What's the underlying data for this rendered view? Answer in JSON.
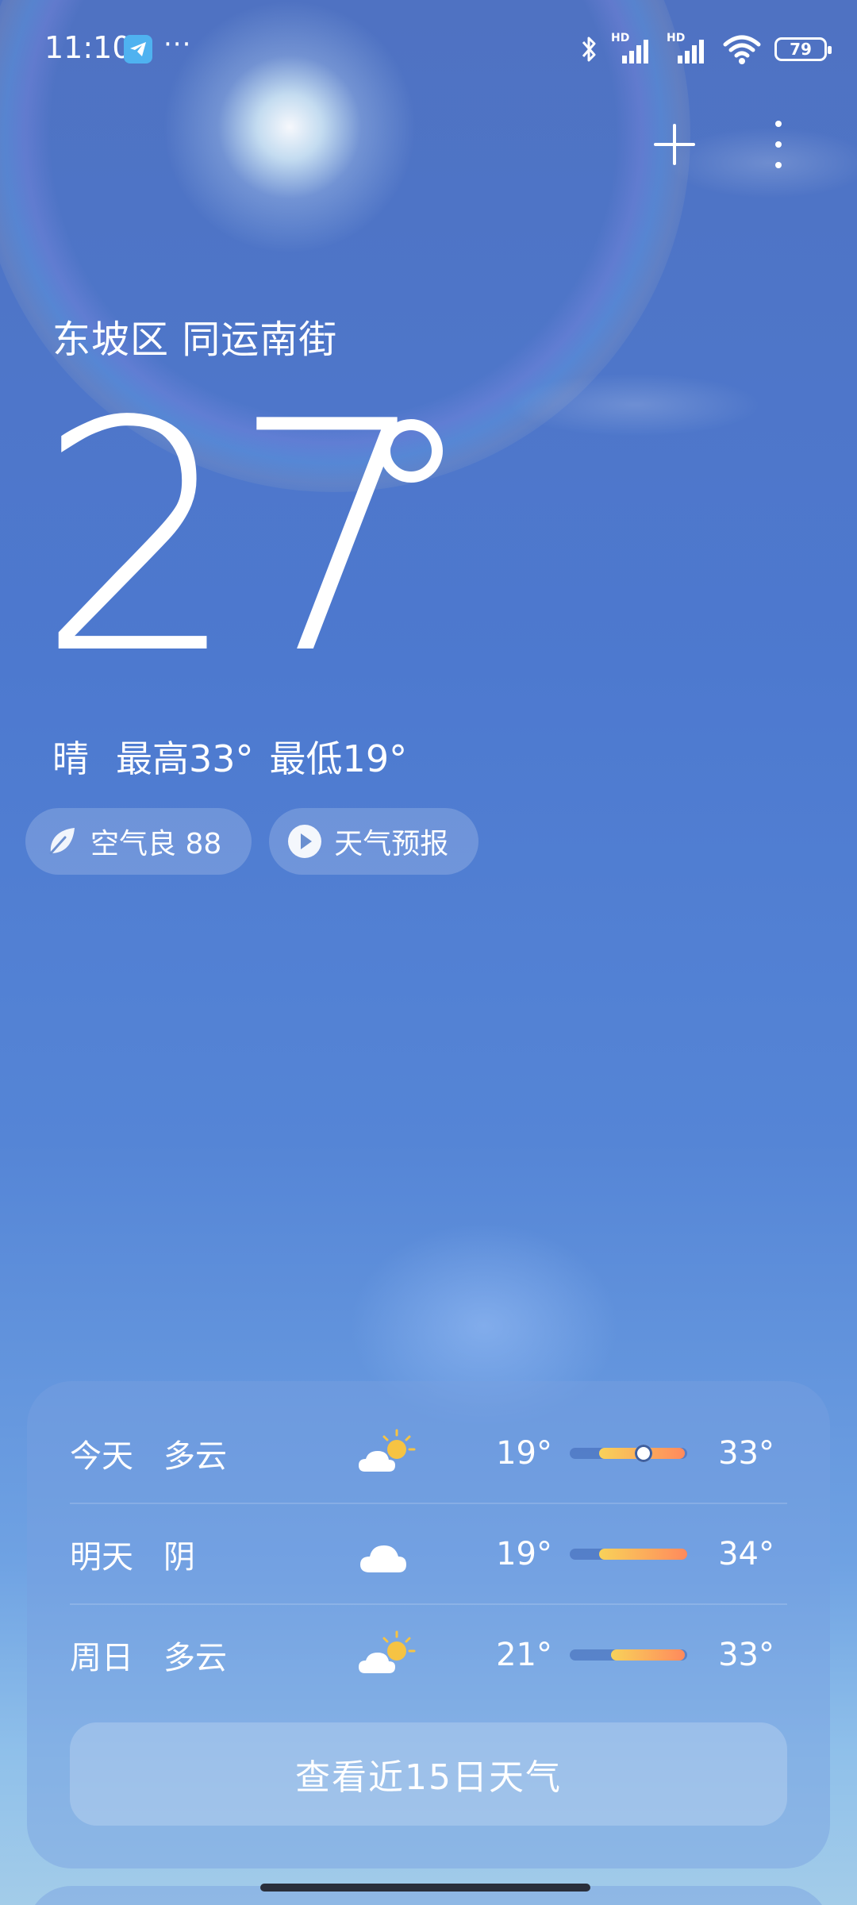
{
  "status_bar": {
    "time": "11:10",
    "more_notifications": "···",
    "signal_label_1": "HD",
    "signal_label_2": "HD",
    "battery": "79"
  },
  "location": "东坡区 同运南街",
  "current": {
    "temperature": "27",
    "condition": "晴",
    "high": "最高33°",
    "low": "最低19°"
  },
  "chips": {
    "air_quality": "空气良 88",
    "forecast_video": "天气预报"
  },
  "forecast": [
    {
      "day": "今天",
      "condition": "多云",
      "icon": "partly-cloudy-icon",
      "low": "19°",
      "high": "33°",
      "range_start": 0.25,
      "range_end": 0.98,
      "current_marker": 0.63
    },
    {
      "day": "明天",
      "condition": "阴",
      "icon": "cloudy-icon",
      "low": "19°",
      "high": "34°",
      "range_start": 0.25,
      "range_end": 1.0
    },
    {
      "day": "周日",
      "condition": "多云",
      "icon": "partly-cloudy-icon",
      "low": "21°",
      "high": "33°",
      "range_start": 0.35,
      "range_end": 0.98
    }
  ],
  "fifteen_day_button": "查看近15日天气",
  "colors": {
    "sky_top": "#4f72c2",
    "sky_bottom": "#a3cce9",
    "bar_warm_start": "#f8d25a",
    "bar_warm_end": "#ff8a5c"
  }
}
